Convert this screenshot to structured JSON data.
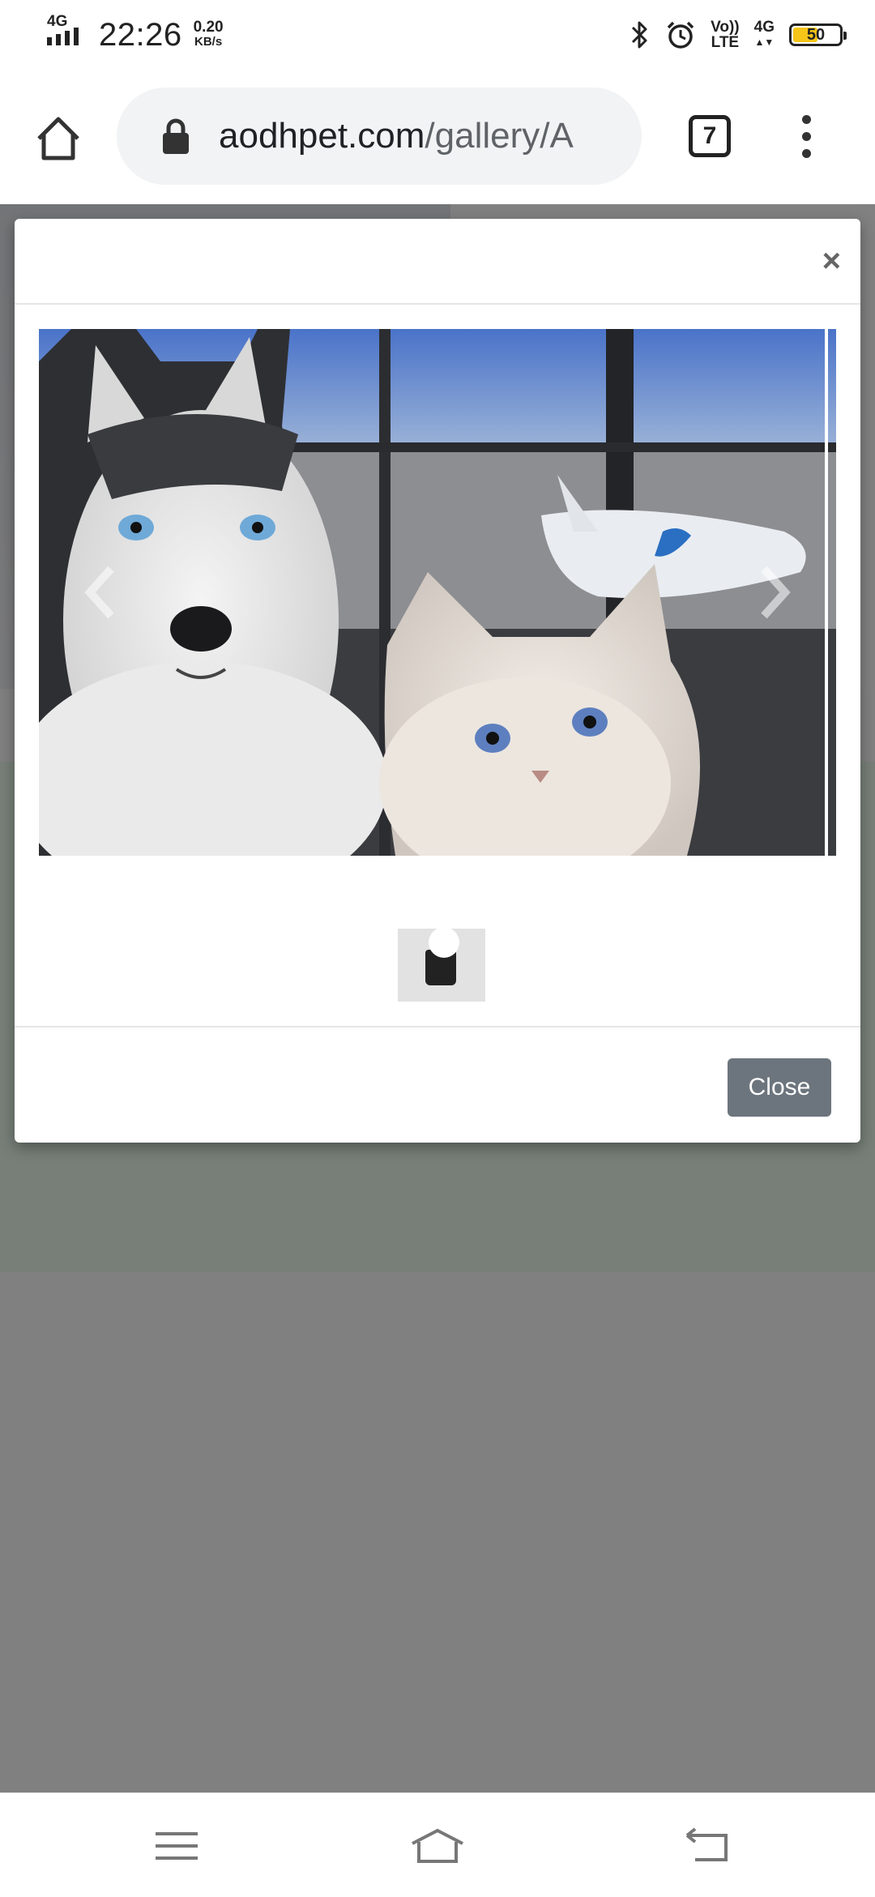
{
  "status_bar": {
    "network_type": "4G",
    "time": "22:26",
    "speed_value": "0.20",
    "speed_unit": "KB/s",
    "volte_line1": "Vo))",
    "volte_line2": "LTE",
    "data_type": "4G",
    "battery_level": "50",
    "battery_color": "#f5c518",
    "icons": [
      "signal-icon",
      "bluetooth-icon",
      "alarm-icon",
      "volte-icon",
      "battery-icon"
    ]
  },
  "browser": {
    "url_domain": "aodhpet.com",
    "url_path": "/gallery/A",
    "tab_count": "7",
    "icons": [
      "home-icon",
      "lock-icon",
      "tabs-icon",
      "more-icon"
    ]
  },
  "modal": {
    "close_symbol": "×",
    "close_button_label": "Close",
    "carousel": {
      "image_subject": "husky puppy and kitten",
      "prev_icon": "chevron-left-icon",
      "next_icon": "chevron-right-icon"
    }
  },
  "colors": {
    "scrim": "#808080",
    "close_button": "#6c757d",
    "page_green": "#4f7a55"
  },
  "nav_bar": {
    "icons": [
      "menu-lines-icon",
      "home-outline-icon",
      "back-icon"
    ]
  }
}
